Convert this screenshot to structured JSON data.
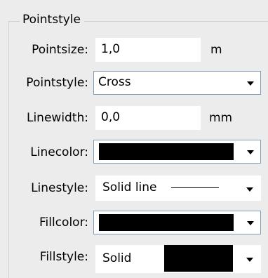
{
  "group": {
    "title": "Pointstyle"
  },
  "pointsize": {
    "label": "Pointsize:",
    "value": "1,0",
    "unit": "m"
  },
  "pointstyle": {
    "label": "Pointstyle:",
    "value": "Cross"
  },
  "linewidth": {
    "label": "Linewidth:",
    "value": "0,0",
    "unit": "mm"
  },
  "linecolor": {
    "label": "Linecolor:",
    "color": "#000000"
  },
  "linestyle": {
    "label": "Linestyle:",
    "value": "Solid line"
  },
  "fillcolor": {
    "label": "Fillcolor:",
    "color": "#000000"
  },
  "fillstyle": {
    "label": "Fillstyle:",
    "value": "Solid",
    "color": "#000000"
  }
}
